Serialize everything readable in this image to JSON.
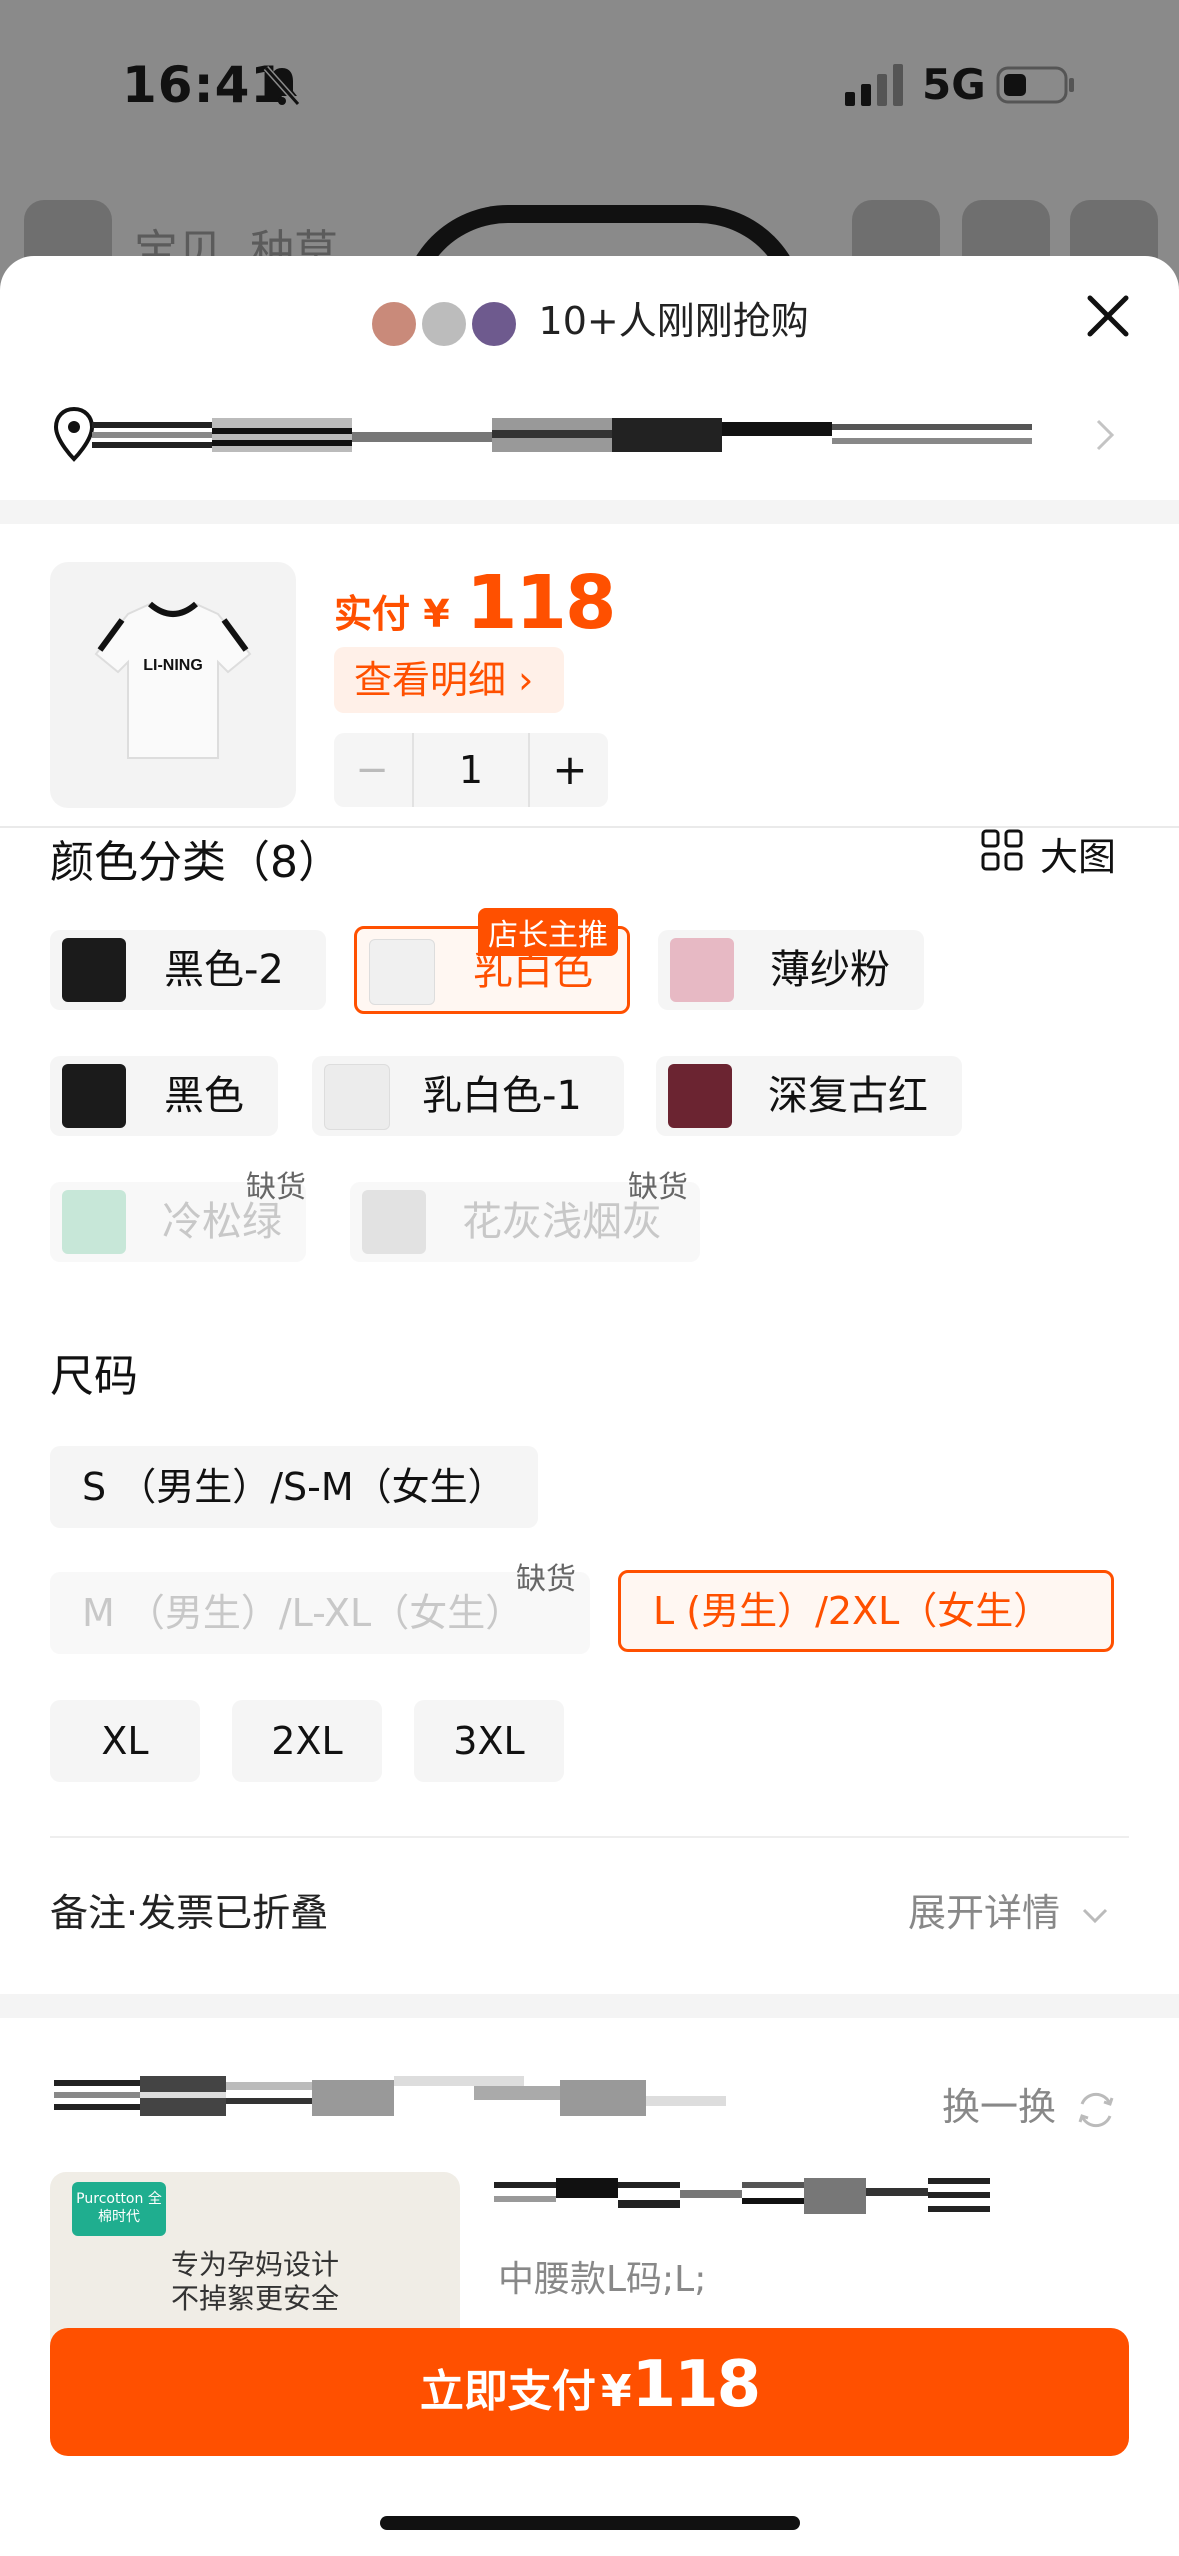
{
  "status_bar": {
    "time": "16:41",
    "network": "5G"
  },
  "background_header": {
    "tab1": "宝贝",
    "tab2": "种草"
  },
  "header": {
    "buyers_text": "10+人刚刚抢购"
  },
  "product": {
    "price_label": "实付 ¥",
    "price": "118",
    "detail_label": "查看明细 ›",
    "quantity": "1",
    "minus": "−",
    "plus": "+",
    "thumb_brand": "LI-NING"
  },
  "color_section": {
    "title": "颜色分类（8）",
    "big_image_label": "大图",
    "options": [
      {
        "label": "黑色-2",
        "color": "#1b1b1b",
        "state": "normal"
      },
      {
        "label": "乳白色",
        "color": "#f0f0f0",
        "state": "selected",
        "tag": "店长主推"
      },
      {
        "label": "薄纱粉",
        "color": "#e7b9c4",
        "state": "normal"
      },
      {
        "label": "黑色",
        "color": "#1b1b1b",
        "state": "normal"
      },
      {
        "label": "乳白色-1",
        "color": "#ececec",
        "state": "normal"
      },
      {
        "label": "深复古红",
        "color": "#6b2431",
        "state": "normal"
      },
      {
        "label": "冷松绿",
        "color": "#9fd9bd",
        "state": "disabled",
        "badge": "缺货"
      },
      {
        "label": "花灰浅烟灰",
        "color": "#d0d0d0",
        "state": "disabled",
        "badge": "缺货"
      }
    ]
  },
  "size_section": {
    "title": "尺码",
    "options": [
      {
        "label": "S （男生）/S-M（女生）",
        "state": "normal"
      },
      {
        "label": "M （男生）/L-XL（女生）",
        "state": "disabled",
        "badge": "缺货"
      },
      {
        "label": "L (男生）/2XL（女生）",
        "state": "selected"
      },
      {
        "label": "XL",
        "state": "normal"
      },
      {
        "label": "2XL",
        "state": "normal"
      },
      {
        "label": "3XL",
        "state": "normal"
      }
    ]
  },
  "notes": {
    "label": "备注·发票已折叠",
    "expand_label": "展开详情"
  },
  "recommend": {
    "swap_label": "换一换",
    "card_brand": "Purcotton 全棉时代",
    "card_text_1": "专为孕妈设计",
    "card_text_2": "不掉絮更安全",
    "subtitle": "中腰款L码;L;"
  },
  "pay_button": {
    "label": "立即支付",
    "currency": "¥",
    "amount": "118"
  },
  "colors": {
    "accent": "#ff5000"
  }
}
